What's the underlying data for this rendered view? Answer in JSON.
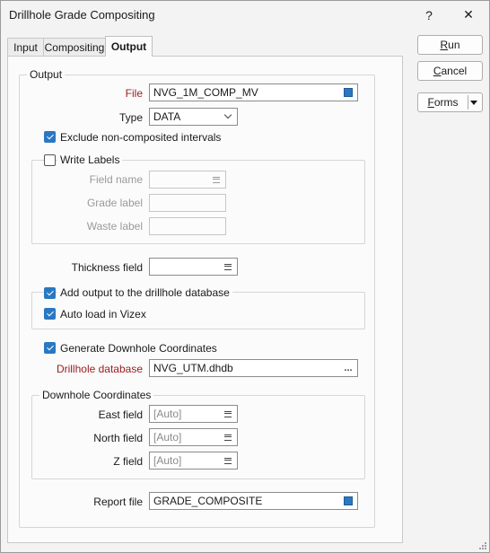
{
  "window": {
    "title": "Drillhole Grade Compositing",
    "help_label": "?",
    "close_label": "✕"
  },
  "tabs": [
    {
      "label": "Input"
    },
    {
      "label": "Compositing"
    },
    {
      "label": "Output",
      "active": true
    }
  ],
  "buttons": {
    "run": {
      "accel": "R",
      "rest": "un"
    },
    "cancel": {
      "accel": "C",
      "rest": "ancel"
    },
    "forms": {
      "accel": "F",
      "rest": "orms"
    }
  },
  "output_group": {
    "legend": "Output",
    "file": {
      "label": "File",
      "value": "NVG_1M_COMP_MV"
    },
    "type": {
      "label": "Type",
      "value": "DATA"
    },
    "exclude": {
      "label": "Exclude non-composited intervals",
      "checked": true
    }
  },
  "write_labels": {
    "label": "Write Labels",
    "checked": false,
    "field_name": {
      "label": "Field name",
      "value": ""
    },
    "grade_label": {
      "label": "Grade label",
      "value": ""
    },
    "waste_label": {
      "label": "Waste label",
      "value": ""
    }
  },
  "thickness": {
    "label": "Thickness field",
    "value": ""
  },
  "add_output": {
    "label": "Add output to the drillhole database",
    "checked": true
  },
  "auto_load": {
    "label": "Auto load in Vizex",
    "checked": true
  },
  "generate": {
    "label": "Generate Downhole Coordinates",
    "checked": true
  },
  "drillhole_db": {
    "label": "Drillhole database",
    "value": "NVG_UTM.dhdb",
    "browse": "..."
  },
  "downhole": {
    "legend": "Downhole Coordinates",
    "east": {
      "label": "East field",
      "value": "[Auto]"
    },
    "north": {
      "label": "North field",
      "value": "[Auto]"
    },
    "z": {
      "label": "Z field",
      "value": "[Auto]"
    }
  },
  "report": {
    "label": "Report file",
    "value": "GRADE_COMPOSITE"
  },
  "colors": {
    "accent": "#2a78c2",
    "required_label": "#9b1c1c"
  }
}
